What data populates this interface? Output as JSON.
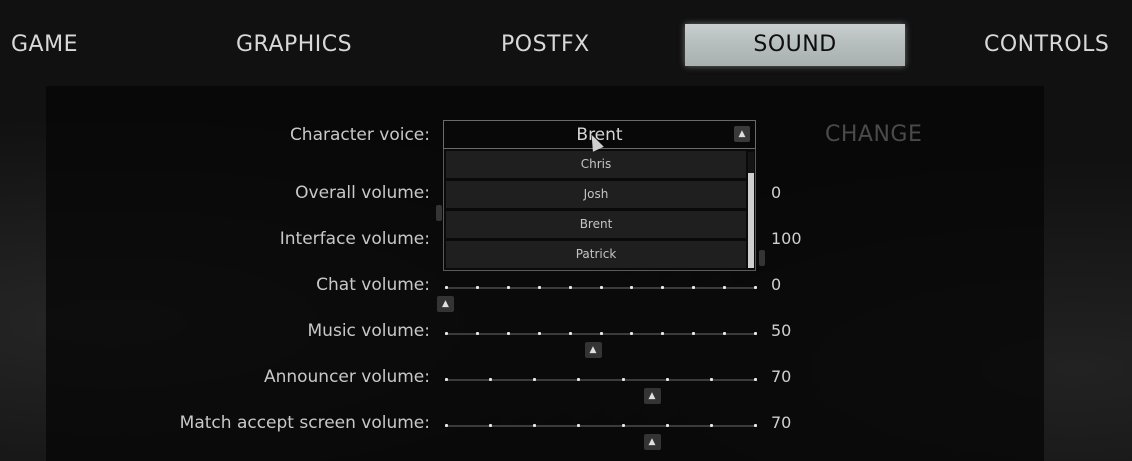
{
  "tabs": [
    {
      "label": "GAME"
    },
    {
      "label": "GRAPHICS"
    },
    {
      "label": "POSTFX"
    },
    {
      "label": "SOUND",
      "active": true
    },
    {
      "label": "CONTROLS"
    }
  ],
  "character_voice": {
    "label": "Character voice:",
    "selected": "Brent",
    "change_label": "CHANGE",
    "options": [
      "Chris",
      "Josh",
      "Brent",
      "Patrick"
    ]
  },
  "settings": [
    {
      "label": "Overall volume:",
      "value": "0",
      "level": 0
    },
    {
      "label": "Interface volume:",
      "value": "100",
      "level": 100
    },
    {
      "label": "Chat volume:",
      "value": "0",
      "level": 0
    },
    {
      "label": "Music volume:",
      "value": "50",
      "level": 50
    },
    {
      "label": "Announcer volume:",
      "value": "70",
      "level": 70
    },
    {
      "label": "Match accept screen volume:",
      "value": "70",
      "level": 70
    }
  ],
  "icons": {
    "caret": "chevron-up-icon",
    "handle": "chevron-up-icon",
    "cursor": "mouse-cursor-icon"
  },
  "colors": {
    "active_tab_bg": "#b9c0c0",
    "text": "#d8d8d8",
    "disabled_text": "#4a4a4a"
  }
}
